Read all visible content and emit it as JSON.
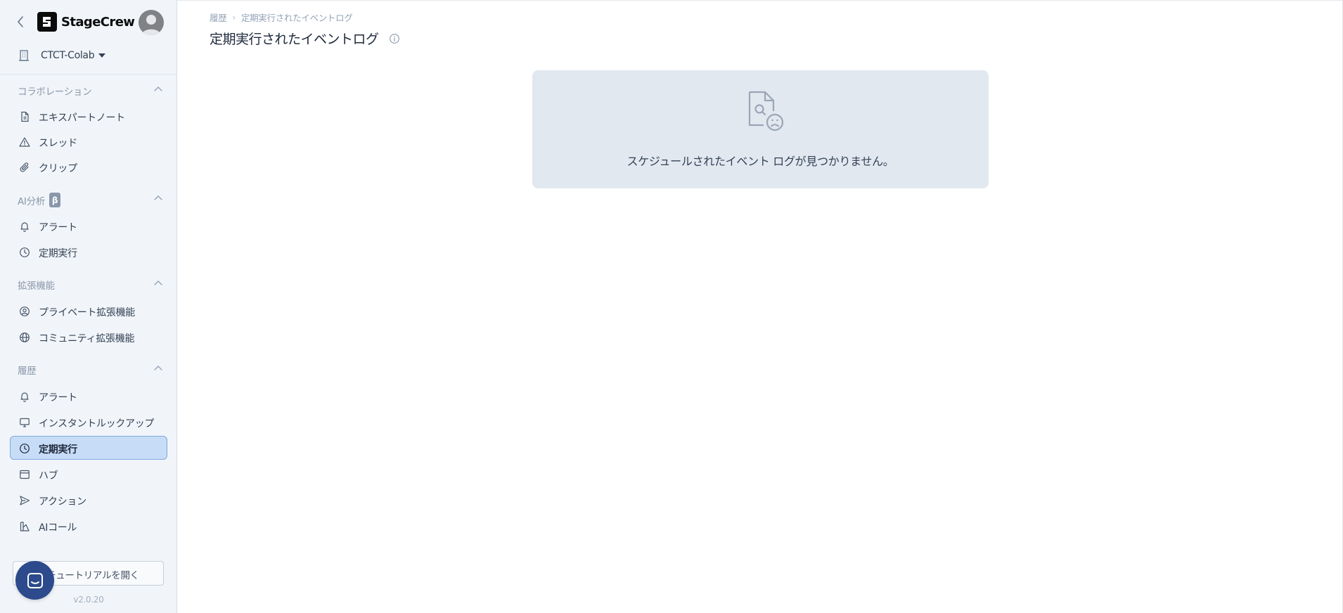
{
  "app": {
    "brand": "StageCrew",
    "org_name": "CTCT-Colab",
    "version": "v2.0.20"
  },
  "sidebar": {
    "sections": [
      {
        "title": "コラボレーション",
        "items": [
          {
            "label": "エキスパートノート",
            "icon": "document-icon"
          },
          {
            "label": "スレッド",
            "icon": "warning-triangle-icon"
          },
          {
            "label": "クリップ",
            "icon": "paperclip-icon"
          }
        ]
      },
      {
        "title": "AI分析",
        "badge": "β",
        "items": [
          {
            "label": "アラート",
            "icon": "bell-icon"
          },
          {
            "label": "定期実行",
            "icon": "clock-icon"
          }
        ]
      },
      {
        "title": "拡張機能",
        "items": [
          {
            "label": "プライベート拡張機能",
            "icon": "user-circle-icon"
          },
          {
            "label": "コミュニティ拡張機能",
            "icon": "globe-icon"
          }
        ]
      },
      {
        "title": "履歴",
        "items": [
          {
            "label": "アラート",
            "icon": "bell-icon"
          },
          {
            "label": "インスタントルックアップ",
            "icon": "monitor-icon"
          },
          {
            "label": "定期実行",
            "icon": "clock-icon",
            "active": true
          },
          {
            "label": "ハブ",
            "icon": "window-icon"
          },
          {
            "label": "アクション",
            "icon": "send-icon"
          },
          {
            "label": "AIコール",
            "icon": "ai-call-icon"
          }
        ]
      }
    ],
    "tutorial_label": "チュートリアルを開く"
  },
  "main": {
    "breadcrumb": [
      "履歴",
      "定期実行されたイベントログ"
    ],
    "title": "定期実行されたイベントログ",
    "empty_message": "スケジュールされたイベント ログが見つかりません。"
  },
  "colors": {
    "sidebar_bg": "#f1f5f9",
    "active_item_bg": "#c7dcf7",
    "active_item_border": "#7fa9e0",
    "empty_card_bg": "#e2e8f0",
    "chat_fab": "#2c4a8c"
  }
}
